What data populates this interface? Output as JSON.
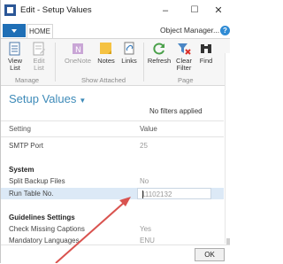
{
  "window": {
    "title": "Edit - Setup Values",
    "minimize_glyph": "–",
    "maximize_glyph": "☐",
    "close_glyph": "✕"
  },
  "ribbon": {
    "home_tab": "HOME",
    "object_manager": "Object Manager...",
    "buttons": {
      "view_list": [
        "View",
        "List"
      ],
      "edit_list": [
        "Edit",
        "List"
      ],
      "onenote": "OneNote",
      "notes": "Notes",
      "links": "Links",
      "refresh": "Refresh",
      "clear_filter": [
        "Clear",
        "Filter"
      ],
      "find": "Find"
    },
    "groups": {
      "manage": "Manage",
      "show_attached": "Show Attached",
      "page": "Page"
    }
  },
  "content": {
    "page_title": "Setup Values",
    "filter_note": "No filters applied",
    "columns": {
      "setting": "Setting",
      "value": "Value"
    },
    "rows": [
      {
        "setting": "SMTP Port",
        "value": "25"
      },
      {
        "setting": "System",
        "value": ""
      },
      {
        "setting": "Split Backup Files",
        "value": "No"
      },
      {
        "setting": "Run Table No.",
        "value": "11102132"
      },
      {
        "setting": "Guidelines Settings",
        "value": ""
      },
      {
        "setting": "Check Missing Captions",
        "value": "Yes"
      },
      {
        "setting": "Mandatory Languages",
        "value": "ENU"
      }
    ],
    "ok_label": "OK"
  },
  "colors": {
    "accent_blue": "#3d8ab8",
    "file_tab": "#1f6fb6",
    "selected_row": "#dce9f6",
    "annotation_arrow": "#d9534f"
  }
}
